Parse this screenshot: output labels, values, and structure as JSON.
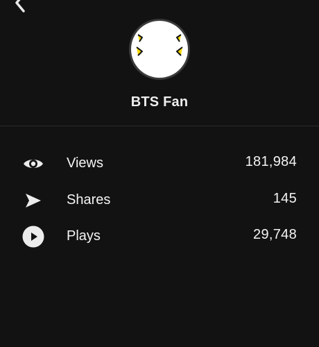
{
  "nav": {
    "back_icon": "chevron-left-icon"
  },
  "profile": {
    "name": "BTS Fan",
    "avatar_icon": "cartoon-face-avatar"
  },
  "stats": [
    {
      "icon": "eye-icon",
      "label": "Views",
      "value": "181,984"
    },
    {
      "icon": "share-arrow-icon",
      "label": "Shares",
      "value": "145"
    },
    {
      "icon": "play-circle-icon",
      "label": "Plays",
      "value": "29,748"
    }
  ],
  "colors": {
    "background": "#121212",
    "text": "#f4f4f4",
    "divider": "#2c2c2c",
    "avatar_accent": "#f5d800"
  }
}
